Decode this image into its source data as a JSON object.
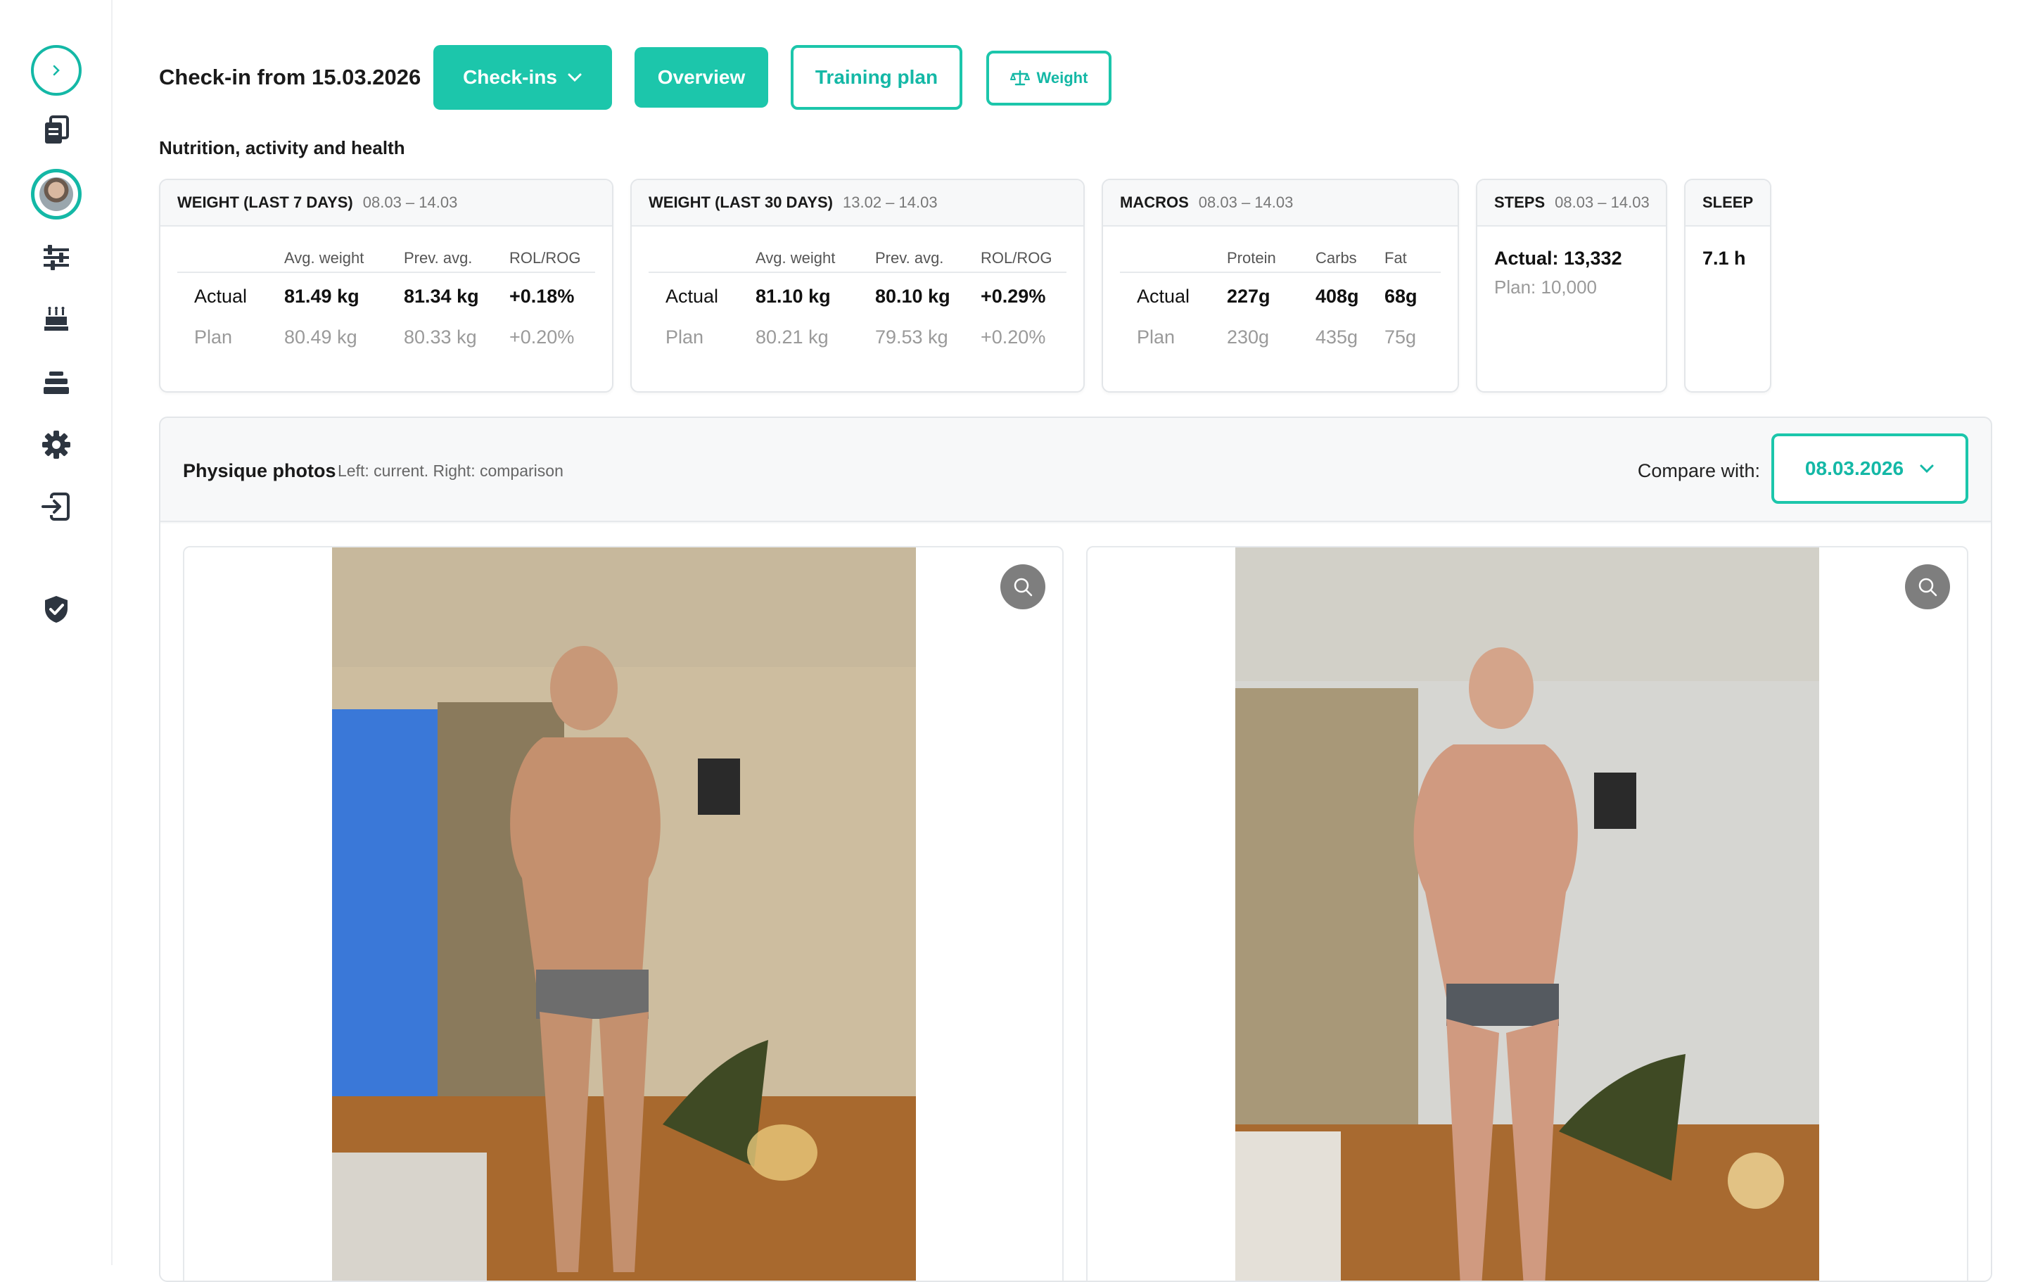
{
  "header": {
    "title": "Check-in from 15.03.2026",
    "checkins_label": "Check-ins",
    "overview_label": "Overview",
    "training_plan_label": "Training plan",
    "weight_label": "Weight"
  },
  "section_title": "Nutrition, activity and health",
  "cards": {
    "weight7": {
      "title": "WEIGHT (LAST 7 DAYS)",
      "date": "08.03 – 14.03",
      "headers": [
        "Avg. weight",
        "Prev. avg.",
        "ROL/ROG"
      ],
      "actual": {
        "label": "Actual",
        "values": [
          "81.49 kg",
          "81.34 kg",
          "+0.18%"
        ]
      },
      "plan": {
        "label": "Plan",
        "values": [
          "80.49 kg",
          "80.33 kg",
          "+0.20%"
        ]
      }
    },
    "weight30": {
      "title": "WEIGHT (LAST 30 DAYS)",
      "date": "13.02 – 14.03",
      "headers": [
        "Avg. weight",
        "Prev. avg.",
        "ROL/ROG"
      ],
      "actual": {
        "label": "Actual",
        "values": [
          "81.10 kg",
          "80.10 kg",
          "+0.29%"
        ]
      },
      "plan": {
        "label": "Plan",
        "values": [
          "80.21 kg",
          "79.53 kg",
          "+0.20%"
        ]
      }
    },
    "macros": {
      "title": "MACROS",
      "date": "08.03 – 14.03",
      "headers": [
        "Protein",
        "Carbs",
        "Fat"
      ],
      "actual": {
        "label": "Actual",
        "values": [
          "227g",
          "408g",
          "68g"
        ]
      },
      "plan": {
        "label": "Plan",
        "values": [
          "230g",
          "435g",
          "75g"
        ]
      }
    },
    "steps": {
      "title": "STEPS",
      "date": "08.03 – 14.03",
      "actual": "Actual: 13,332",
      "plan": "Plan: 10,000"
    },
    "sleep": {
      "title": "SLEEP",
      "value": "7.1 h"
    }
  },
  "physique": {
    "title": "Physique photos",
    "subtitle": "Left: current. Right: comparison",
    "compare_label": "Compare with:",
    "compare_value": "08.03.2026"
  },
  "colors": {
    "accent": "#1cc6ab",
    "sidebar_icon": "#2d3540"
  },
  "icons": {
    "sidebar": [
      "chevron-right-icon",
      "documents-icon",
      "avatar",
      "sliders-icon",
      "cake-icon",
      "layers-icon",
      "gear-icon",
      "logout-icon",
      "shield-check-icon"
    ],
    "zoom": "magnifier-icon",
    "weight": "scale-icon"
  }
}
